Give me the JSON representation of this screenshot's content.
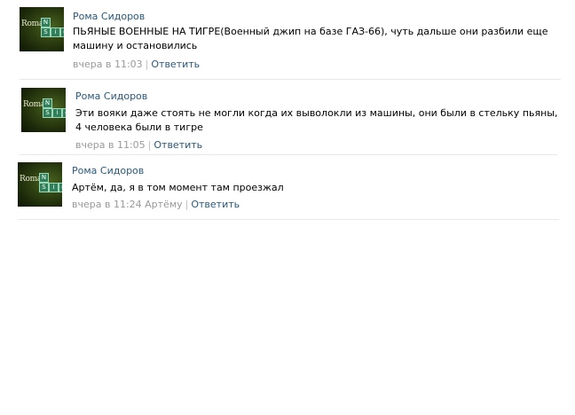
{
  "comments": [
    {
      "author": "Рома Сидоров",
      "avatar_text": "Roma",
      "avatar_tiles": [
        "N",
        "S",
        "i",
        "d"
      ],
      "lines": [
        "ПЬЯНЫЕ ВОЕННЫЕ НА ТИГРЕ(Военный джип на базе ГАЗ-66), чуть дальше они разбили еще",
        "машину и остановились"
      ],
      "time": "вчера в 11:03",
      "reply_label": "Ответить"
    },
    {
      "author": "Рома Сидоров",
      "avatar_text": "Roma",
      "avatar_tiles": [
        "N",
        "S",
        "i",
        "d"
      ],
      "lines": [
        "Эти вояки даже стоять не могли когда их выволокли из машины, они были в стельку пьяны,",
        "4 человека были в тигре"
      ],
      "time": "вчера в 11:05",
      "reply_label": "Ответить"
    },
    {
      "author": "Рома Сидоров",
      "avatar_text": "Roma",
      "avatar_tiles": [
        "N",
        "S",
        "i",
        "d"
      ],
      "lines": [
        "Артём, да, я в том момент там проезжал"
      ],
      "time": "вчера в 11:24 Артёму",
      "reply_label": "Ответить"
    }
  ]
}
